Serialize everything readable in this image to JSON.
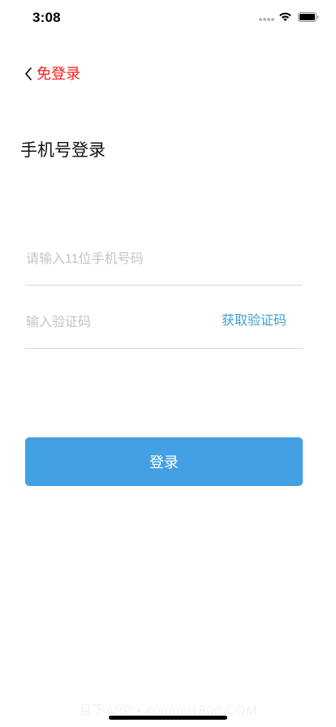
{
  "colors": {
    "accent_red": "#ff1a1a",
    "accent_blue": "#3e9fd9",
    "button_blue": "#43a0e3"
  },
  "status_bar": {
    "time": "3:08",
    "icons": [
      "signal-dots-icon",
      "wifi-icon",
      "battery-icon"
    ]
  },
  "nav": {
    "back_icon": "chevron-left-icon",
    "back_label": "免登录"
  },
  "page": {
    "title": "手机号登录"
  },
  "form": {
    "phone": {
      "value": "",
      "placeholder": "请输入11位手机号码"
    },
    "code": {
      "value": "",
      "placeholder": "输入验证码",
      "get_code_label": "获取验证码"
    },
    "login_label": "登录"
  },
  "watermark": "易下APP • 4008891800.COM"
}
